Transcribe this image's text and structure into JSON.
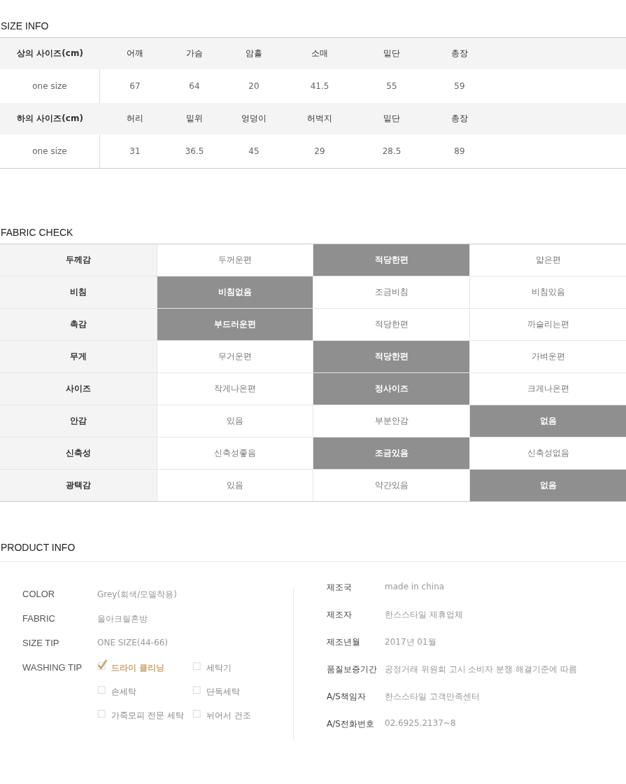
{
  "size_info": {
    "title": "SIZE INFO",
    "groups": [
      {
        "header": [
          "상의 사이즈(cm)",
          "어깨",
          "가슴",
          "암홀",
          "소매",
          "밑단",
          "총장"
        ],
        "values": [
          "one size",
          "67",
          "64",
          "20",
          "41.5",
          "55",
          "59"
        ]
      },
      {
        "header": [
          "하의 사이즈(cm)",
          "허리",
          "밑위",
          "엉덩이",
          "허벅지",
          "밑단",
          "총장"
        ],
        "values": [
          "one size",
          "31",
          "36.5",
          "45",
          "29",
          "28.5",
          "89"
        ]
      }
    ]
  },
  "fabric_check": {
    "title": "FABRIC CHECK",
    "rows": [
      {
        "label": "두께감",
        "options": [
          {
            "text": "두꺼운편",
            "selected": false
          },
          {
            "text": "적당한편",
            "selected": true
          },
          {
            "text": "얇은편",
            "selected": false
          }
        ]
      },
      {
        "label": "비침",
        "options": [
          {
            "text": "비침없음",
            "selected": true
          },
          {
            "text": "조금비침",
            "selected": false
          },
          {
            "text": "비침있음",
            "selected": false
          }
        ]
      },
      {
        "label": "촉감",
        "options": [
          {
            "text": "부드러운편",
            "selected": true
          },
          {
            "text": "적당한편",
            "selected": false
          },
          {
            "text": "까슬리는편",
            "selected": false
          }
        ]
      },
      {
        "label": "무게",
        "options": [
          {
            "text": "무거운편",
            "selected": false
          },
          {
            "text": "적당한편",
            "selected": true
          },
          {
            "text": "가벼운편",
            "selected": false
          }
        ]
      },
      {
        "label": "사이즈",
        "options": [
          {
            "text": "작게나온편",
            "selected": false
          },
          {
            "text": "정사이즈",
            "selected": true
          },
          {
            "text": "크게나온편",
            "selected": false
          }
        ]
      },
      {
        "label": "안감",
        "options": [
          {
            "text": "있음",
            "selected": false
          },
          {
            "text": "부분안감",
            "selected": false
          },
          {
            "text": "없음",
            "selected": true
          }
        ]
      },
      {
        "label": "신축성",
        "options": [
          {
            "text": "신축성좋음",
            "selected": false
          },
          {
            "text": "조금있음",
            "selected": true
          },
          {
            "text": "신축성없음",
            "selected": false
          }
        ]
      },
      {
        "label": "광택감",
        "options": [
          {
            "text": "있음",
            "selected": false
          },
          {
            "text": "약간있음",
            "selected": false
          },
          {
            "text": "없음",
            "selected": true
          }
        ]
      }
    ]
  },
  "product_info": {
    "title": "PRODUCT INFO",
    "left": [
      {
        "label": "COLOR",
        "value": "Grey(회색/모델착용)"
      },
      {
        "label": "FABRIC",
        "value": "울아크릴혼방"
      },
      {
        "label": "SIZE TIP",
        "value": "ONE SIZE(44-66)"
      }
    ],
    "washing_tip": {
      "label": "WASHING TIP",
      "options": [
        {
          "text": "드라이 클리닝",
          "checked": true
        },
        {
          "text": "세탁기",
          "checked": false
        },
        {
          "text": "손세탁",
          "checked": false
        },
        {
          "text": "단독세탁",
          "checked": false
        },
        {
          "text": "가죽모피 전문 세탁",
          "checked": false
        },
        {
          "text": "뉘어서 건조",
          "checked": false
        }
      ]
    },
    "right": [
      {
        "label": "제조국",
        "value": "made in china"
      },
      {
        "label": "제조자",
        "value": "한스스타일 제휴업체"
      },
      {
        "label": "제조년월",
        "value": "2017년 01월"
      },
      {
        "label": "품질보증기간",
        "value": "공정거래 위원회 고시 소비자 분쟁 해결기준에 따름"
      },
      {
        "label": "A/S책임자",
        "value": "한스스타일 고객만족센터"
      },
      {
        "label": "A/S전화번호",
        "value": "02.6925.2137~8"
      }
    ]
  }
}
